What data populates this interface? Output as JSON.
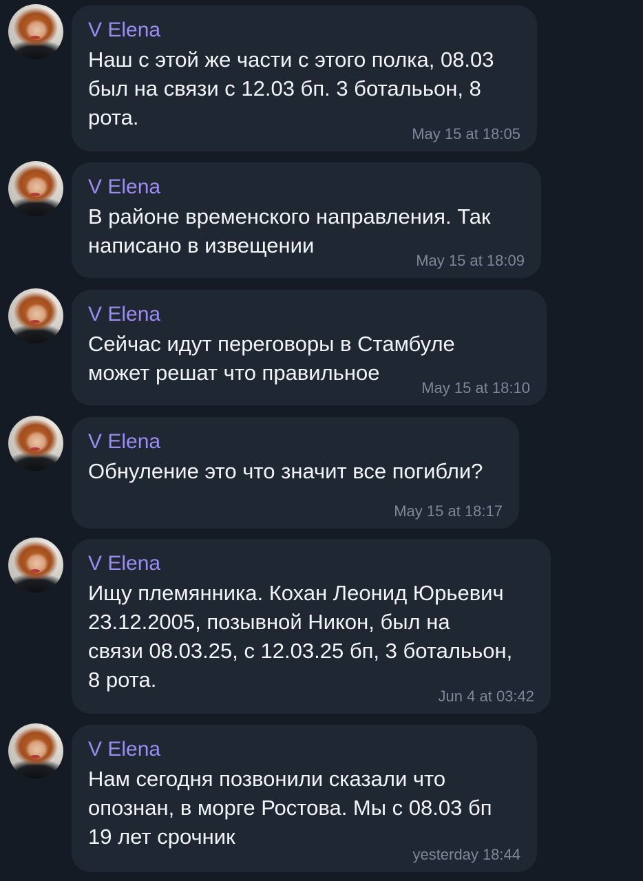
{
  "messages": [
    {
      "sender": "V Elena",
      "text": "Наш с этой же части с этого полка, 08.03\nбыл на связи с 12.03 бп. 3 боталььон, 8\nрота.",
      "time": "May 15 at 18:05"
    },
    {
      "sender": "V Elena",
      "text": "В районе временского направления. Так\nнаписано в извещении",
      "time": "May 15 at 18:09"
    },
    {
      "sender": "V Elena",
      "text": "Сейчас идут переговоры в Стамбуле\nможет решат что правильное",
      "time": "May 15 at 18:10"
    },
    {
      "sender": "V Elena",
      "text": "Обнуление это что значит все погибли?",
      "time": "May 15 at 18:17"
    },
    {
      "sender": "V Elena",
      "text": "Ищу племянника. Кохан Леонид Юрьевич\n23.12.2005, позывной Никон, был на\nсвязи 08.03.25, с 12.03.25 бп, 3 боталььон,\n8 рота.",
      "time": "Jun 4 at 03:42"
    },
    {
      "sender": "V Elena",
      "text": "Нам сегодня позвонили сказали что\nопознан, в морге Ростова. Мы с 08.03 бп\n19 лет срочник",
      "time": "yesterday 18:44"
    }
  ]
}
